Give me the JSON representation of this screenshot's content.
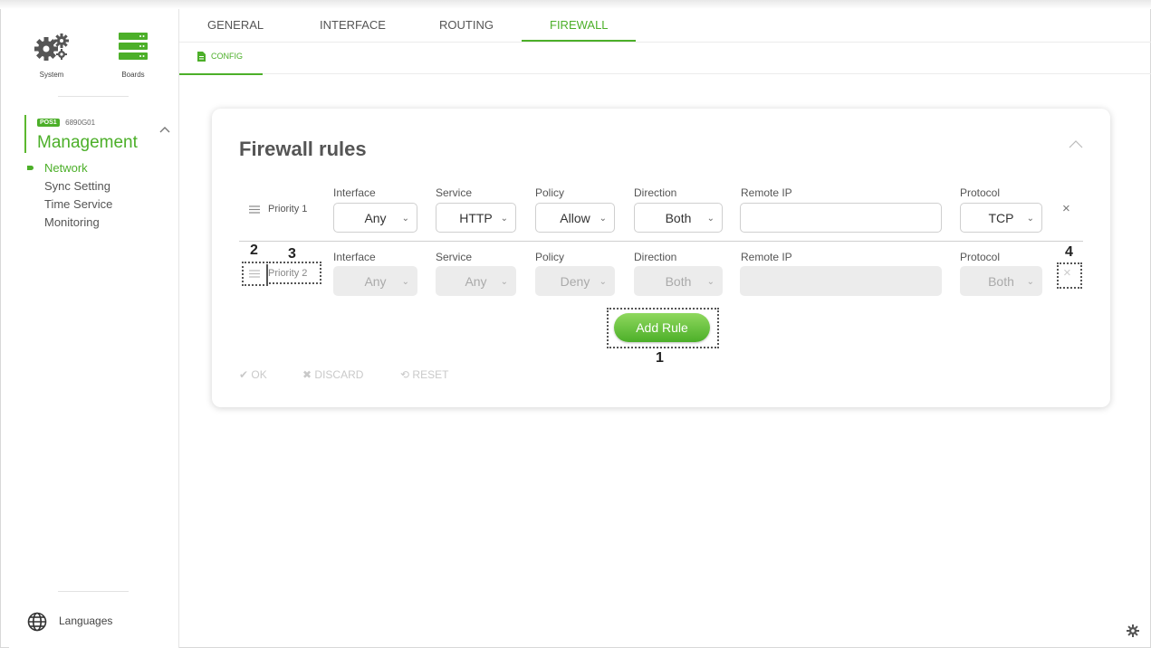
{
  "sidebar": {
    "system_label": "System",
    "boards_label": "Boards",
    "board_badge": "POS1",
    "board_id": "6890G01",
    "section_title": "Management",
    "items": [
      {
        "label": "Network"
      },
      {
        "label": "Sync Setting"
      },
      {
        "label": "Time Service"
      },
      {
        "label": "Monitoring"
      }
    ],
    "languages_label": "Languages"
  },
  "tabs": [
    {
      "label": "GENERAL"
    },
    {
      "label": "INTERFACE"
    },
    {
      "label": "ROUTING"
    },
    {
      "label": "FIREWALL"
    }
  ],
  "subtab": {
    "label": "CONFIG"
  },
  "card": {
    "title": "Firewall rules",
    "field_labels": {
      "interface": "Interface",
      "service": "Service",
      "policy": "Policy",
      "direction": "Direction",
      "remote_ip": "Remote IP",
      "protocol": "Protocol"
    },
    "rules": [
      {
        "priority": "Priority 1",
        "interface": "Any",
        "service": "HTTP",
        "policy": "Allow",
        "direction": "Both",
        "remote_ip": "",
        "protocol": "TCP"
      },
      {
        "priority": "Priority 2",
        "interface": "Any",
        "service": "Any",
        "policy": "Deny",
        "direction": "Both",
        "remote_ip": "",
        "protocol": "Both"
      }
    ],
    "add_rule_label": "Add Rule",
    "actions": {
      "ok": "OK",
      "discard": "DISCARD",
      "reset": "RESET"
    }
  },
  "annotations": {
    "n1": "1",
    "n2": "2",
    "n3": "3",
    "n4": "4"
  },
  "colors": {
    "accent": "#4caf29"
  }
}
